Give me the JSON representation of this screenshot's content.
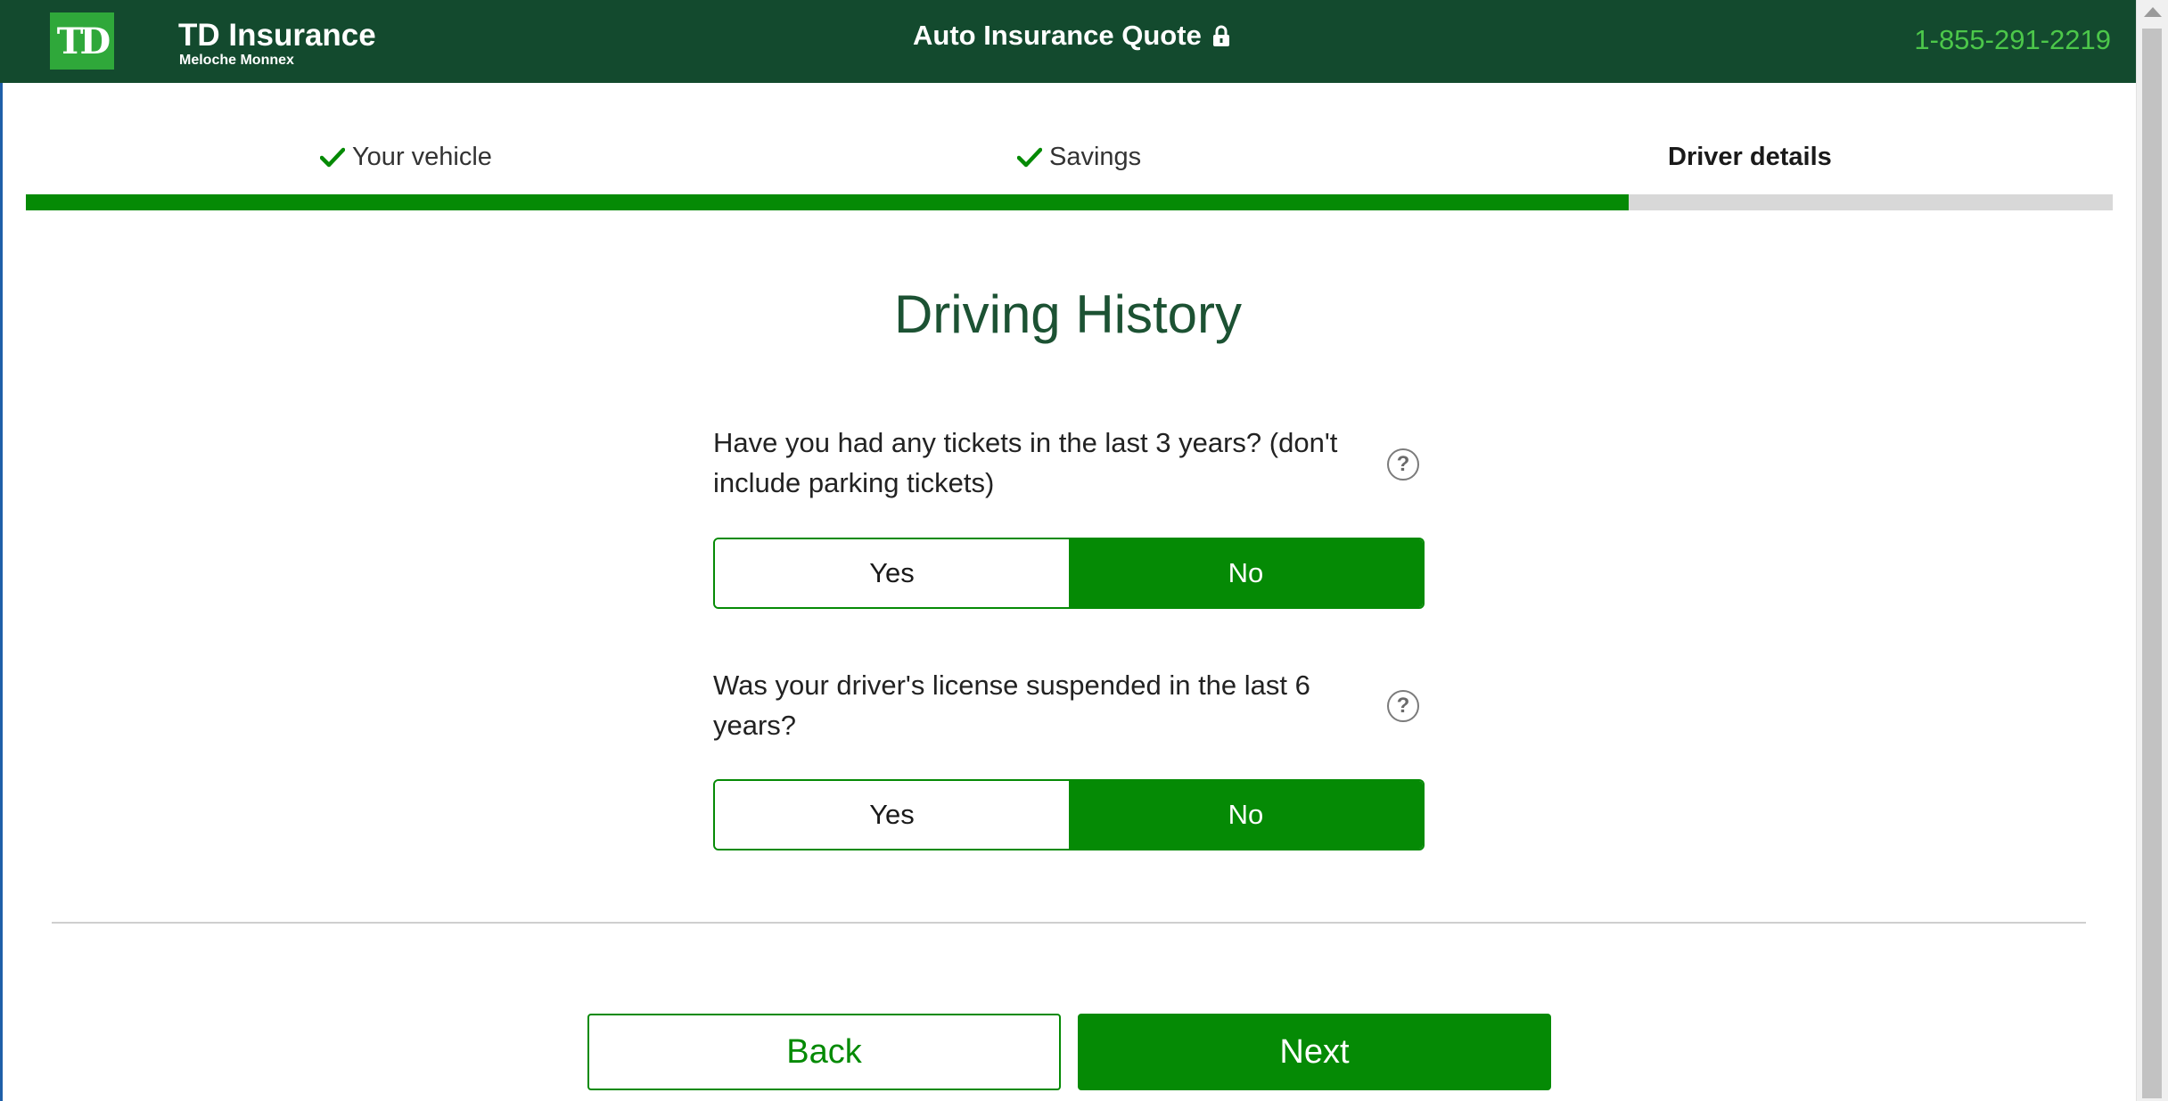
{
  "header": {
    "logo_text": "TD",
    "brand_name": "TD Insurance",
    "brand_sub": "Meloche Monnex",
    "title": "Auto Insurance Quote",
    "phone": "1-855-291-2219"
  },
  "steps": [
    {
      "label": "Your vehicle",
      "status": "complete"
    },
    {
      "label": "Savings",
      "status": "complete"
    },
    {
      "label": "Driver details",
      "status": "current"
    }
  ],
  "progress": {
    "percent": 76.8
  },
  "section": {
    "title": "Driving History"
  },
  "questions": [
    {
      "text": "Have you had any tickets in the last 3 years? (don't include parking tickets)",
      "options": [
        "Yes",
        "No"
      ],
      "selected": "No"
    },
    {
      "text": "Was your driver's license suspended in the last 6 years?",
      "options": [
        "Yes",
        "No"
      ],
      "selected": "No"
    }
  ],
  "help_icon_glyph": "?",
  "buttons": {
    "back": "Back",
    "next": "Next"
  },
  "colors": {
    "header_bg": "#134a2e",
    "brand_green": "#058a05",
    "phone_green": "#4cc74a",
    "title_green": "#1c5233"
  },
  "icons": [
    "lock-icon",
    "check-icon",
    "help-icon"
  ]
}
